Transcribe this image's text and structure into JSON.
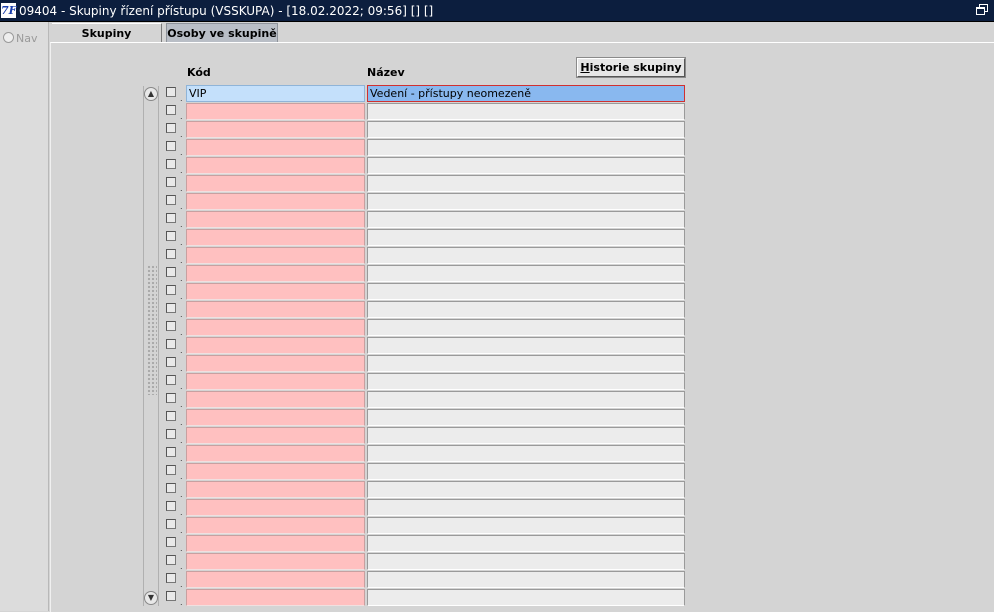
{
  "window": {
    "title": "09404 - Skupiny řízení přístupu (VSSKUPA) - [18.02.2022; 09:56]  []  []",
    "icon_text": "7F"
  },
  "nav": {
    "label": "Nav"
  },
  "tabs": [
    {
      "label": "Skupiny",
      "active": true
    },
    {
      "label": "Osoby ve skupině",
      "active": false
    }
  ],
  "buttons": {
    "history": "istorie skupiny",
    "history_hotkey": "H"
  },
  "columns": {
    "code": "Kód",
    "name": "Název"
  },
  "rows": [
    {
      "code": "VIP",
      "name": "Vedení - přístupy neomezeně"
    },
    {
      "code": "",
      "name": ""
    },
    {
      "code": "",
      "name": ""
    },
    {
      "code": "",
      "name": ""
    },
    {
      "code": "",
      "name": ""
    },
    {
      "code": "",
      "name": ""
    },
    {
      "code": "",
      "name": ""
    },
    {
      "code": "",
      "name": ""
    },
    {
      "code": "",
      "name": ""
    },
    {
      "code": "",
      "name": ""
    },
    {
      "code": "",
      "name": ""
    },
    {
      "code": "",
      "name": ""
    },
    {
      "code": "",
      "name": ""
    },
    {
      "code": "",
      "name": ""
    },
    {
      "code": "",
      "name": ""
    },
    {
      "code": "",
      "name": ""
    },
    {
      "code": "",
      "name": ""
    },
    {
      "code": "",
      "name": ""
    },
    {
      "code": "",
      "name": ""
    },
    {
      "code": "",
      "name": ""
    },
    {
      "code": "",
      "name": ""
    },
    {
      "code": "",
      "name": ""
    },
    {
      "code": "",
      "name": ""
    },
    {
      "code": "",
      "name": ""
    },
    {
      "code": "",
      "name": ""
    },
    {
      "code": "",
      "name": ""
    },
    {
      "code": "",
      "name": ""
    },
    {
      "code": "",
      "name": ""
    },
    {
      "code": "",
      "name": ""
    }
  ],
  "colors": {
    "titlebar": "#0c1e3e",
    "code_field_empty": "#ffc0c0",
    "name_field_empty": "#ececec",
    "code_field_selected": "#c4e0fb",
    "name_field_selected": "#89b8ef",
    "selected_border": "#d03030"
  }
}
